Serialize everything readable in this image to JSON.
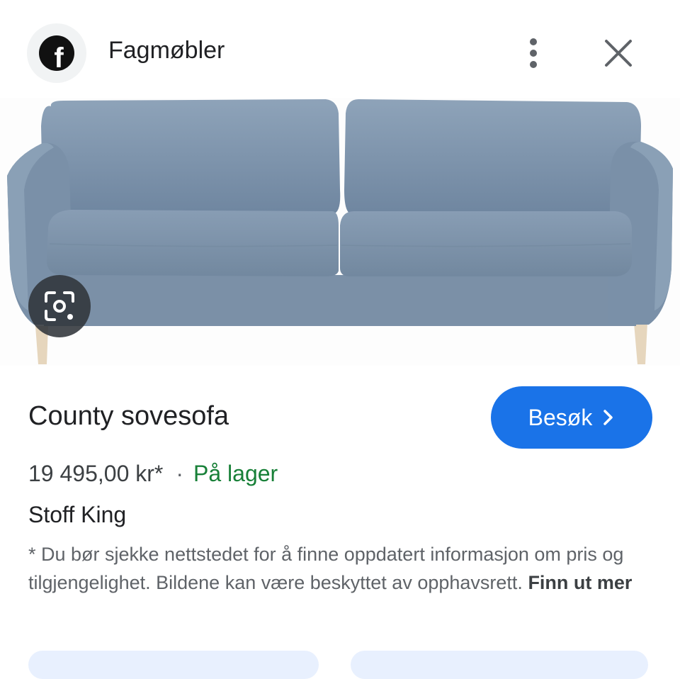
{
  "header": {
    "source_name": "Fagmøbler",
    "logo_letter": "f",
    "icons": {
      "logo": "facebook-icon",
      "more": "more-vert-icon",
      "close": "close-icon"
    }
  },
  "image": {
    "subject": "blue fabric sofa",
    "lens_icon": "google-lens-icon"
  },
  "product": {
    "title": "County sovesofa",
    "price": "19 495,00 kr*",
    "separator": "·",
    "availability": "På lager",
    "material": "Stoff King",
    "disclaimer": "* Du bør sjekke nettstedet for å finne oppdatert informasjon om pris og tilgjengelighet. Bildene kan være beskyttet av opphavsrett.",
    "learn_more": "Finn ut mer"
  },
  "actions": {
    "visit_label": "Besøk",
    "visit_icon": "chevron-right-icon"
  },
  "colors": {
    "accent": "#1a73e8",
    "in_stock": "#188038",
    "sofa": "#7d93ab"
  }
}
